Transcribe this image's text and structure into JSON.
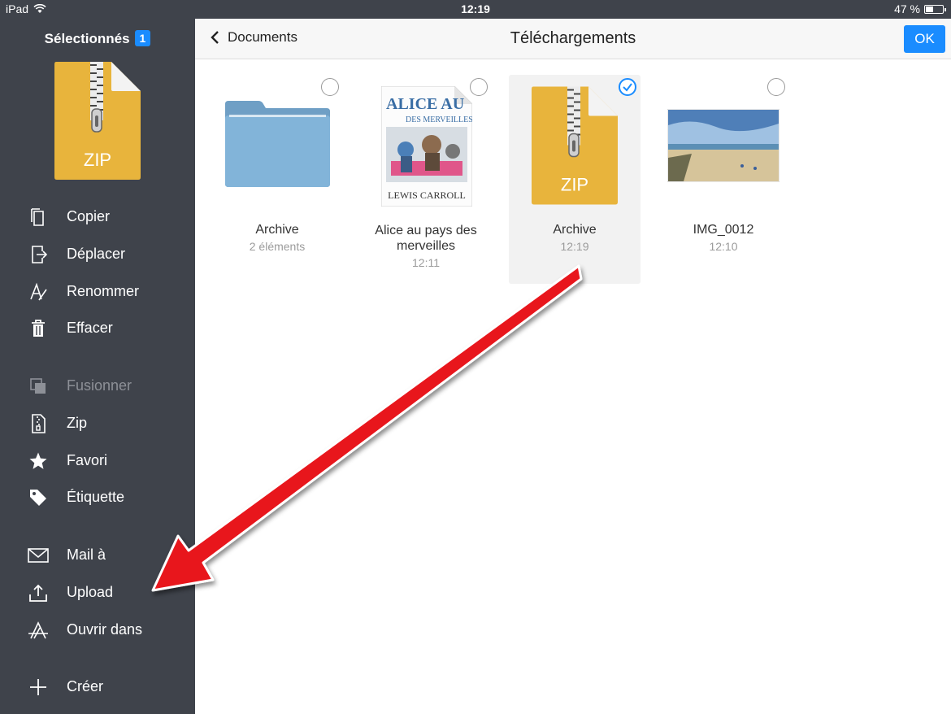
{
  "status_bar": {
    "device": "iPad",
    "time": "12:19",
    "battery": "47 %",
    "battery_level": 0.47
  },
  "sidebar": {
    "header": "Sélectionnés",
    "badge": "1",
    "zip_label": "ZIP",
    "items": [
      {
        "label": "Copier",
        "icon": "copy-icon"
      },
      {
        "label": "Déplacer",
        "icon": "move-icon"
      },
      {
        "label": "Renommer",
        "icon": "rename-icon"
      },
      {
        "label": "Effacer",
        "icon": "trash-icon"
      },
      {
        "label": "Fusionner",
        "icon": "merge-icon",
        "disabled": true
      },
      {
        "label": "Zip",
        "icon": "zip-icon"
      },
      {
        "label": "Favori",
        "icon": "star-icon"
      },
      {
        "label": "Étiquette",
        "icon": "tag-icon"
      },
      {
        "label": "Mail à",
        "icon": "mail-icon"
      },
      {
        "label": "Upload",
        "icon": "upload-icon"
      },
      {
        "label": "Ouvrir dans",
        "icon": "open-in-icon"
      },
      {
        "label": "Créer",
        "icon": "plus-icon"
      }
    ]
  },
  "navbar": {
    "back_label": "Documents",
    "title": "Téléchargements",
    "ok_label": "OK"
  },
  "files": [
    {
      "name": "Archive",
      "meta": "2 éléments",
      "type": "folder",
      "selected": false
    },
    {
      "name": "Alice au pays des merveilles",
      "meta": "12:11",
      "type": "book",
      "selected": false,
      "cover_title_1": "ALICE AU",
      "cover_title_2": "DES MERVEILLES",
      "cover_author": "LEWIS CARROLL"
    },
    {
      "name": "Archive",
      "meta": "12:19",
      "type": "zip",
      "selected": true,
      "zip_label": "ZIP"
    },
    {
      "name": "IMG_0012",
      "meta": "12:10",
      "type": "image",
      "selected": false
    }
  ],
  "colors": {
    "sidebar_bg": "#3f434b",
    "accent": "#1a8cff",
    "zip_gold": "#e8b43c",
    "folder_blue": "#7fb1d6",
    "arrow_red": "#e8141b"
  }
}
